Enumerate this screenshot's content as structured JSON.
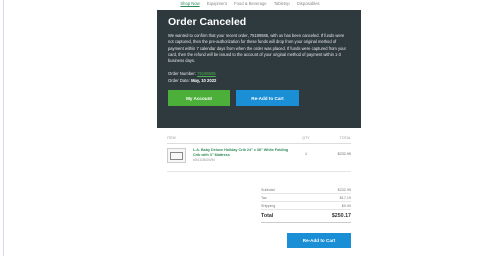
{
  "nav": {
    "items": [
      "Shop Now",
      "Equipment",
      "Food & Beverage",
      "Tabletop",
      "Disposables"
    ]
  },
  "hero": {
    "title": "Order Canceled",
    "message": "We wanted to confirm that your recent order, 75189585, with us has been canceled. If funds were not captured, then the pre-authorization for these funds will drop from your original method of payment within 7 calendar days from when the order was placed. If funds were captured from your card, then the refund will be issued to the account of your original method of payment within 1-3 business days.",
    "order_number_label": "Order Number:",
    "order_number": "75189585",
    "order_date_label": "Order Date:",
    "order_date": "May, 10 2022",
    "my_account_label": "My Account",
    "readd_label": "Re-Add to Cart"
  },
  "table": {
    "col_item": "ITEM",
    "col_qty": "QTY",
    "col_total": "TOTAL"
  },
  "item": {
    "name": "L.A. Baby Deluxe Holiday Crib 24\" x 38\" White Folding Crib with 3\" Mattress",
    "sub": "#5411BDWM",
    "qty": "1",
    "total": "$232.99"
  },
  "totals": {
    "subtotal_label": "Subtotal",
    "subtotal": "$232.99",
    "tax_label": "Tax",
    "tax": "$17.19",
    "shipping_label": "Shipping",
    "shipping": "$0.00",
    "total_label": "Total",
    "total": "$250.17"
  },
  "footer": {
    "readd_label": "Re-Add to Cart"
  },
  "colors": {
    "hero_bg": "#2f3a3f",
    "green": "#4caf3a",
    "blue": "#1a8fd6",
    "link_green": "#2e8b57"
  }
}
